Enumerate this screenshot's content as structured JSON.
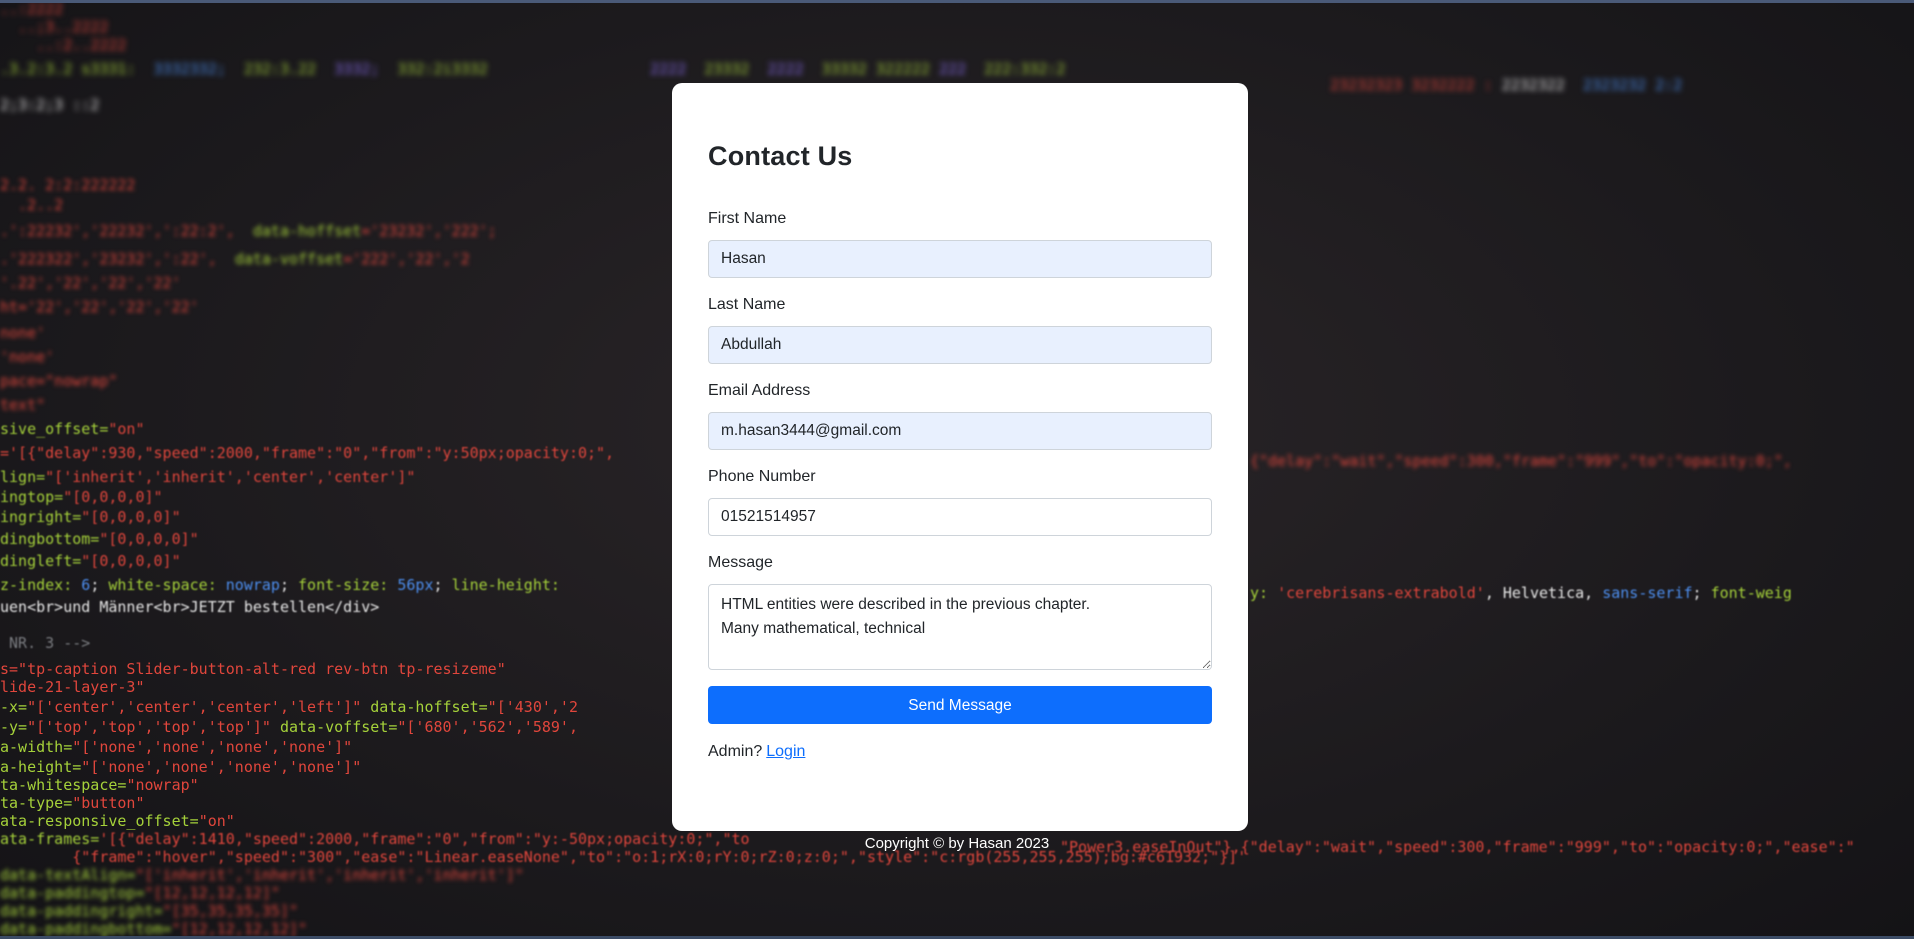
{
  "page": {
    "title": "Contact Us"
  },
  "form": {
    "first_name_label": "First Name",
    "first_name_value": "Hasan",
    "last_name_label": "Last Name",
    "last_name_value": "Abdullah",
    "email_label": "Email Address",
    "email_value": "m.hasan3444@gmail.com",
    "phone_label": "Phone Number",
    "phone_value": "01521514957",
    "message_label": "Message",
    "message_value": "HTML entities were described in the previous chapter.\nMany mathematical, technical",
    "submit_label": "Send Message"
  },
  "admin": {
    "prompt": "Admin?",
    "login_label": "Login"
  },
  "footer": {
    "copyright": "Copyright © by Hasan 2023"
  },
  "colors": {
    "primary": "#0d6efd",
    "autofill": "#e8f0fe",
    "card": "#ffffff",
    "background": "#1c1a1d"
  }
}
